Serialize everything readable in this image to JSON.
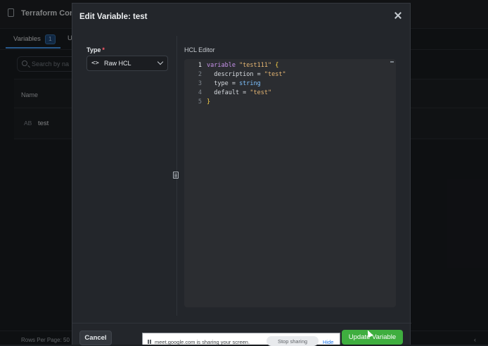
{
  "background": {
    "app_title": "Terraform Con",
    "tabs": [
      {
        "label": "Variables",
        "badge": "1"
      },
      {
        "label": "U"
      }
    ],
    "search_placeholder": "Search by na",
    "table": {
      "header_name": "Name",
      "rows": [
        {
          "type_abbr": "AB",
          "name": "test"
        }
      ]
    },
    "footer": {
      "rows_per_page": "Rows Per Page:  50",
      "pager_prev": "‹"
    }
  },
  "modal": {
    "title": "Edit Variable: test",
    "type_label": "Type",
    "required_mark": "*",
    "type_value_icon": "<>",
    "type_value": "Raw HCL",
    "editor_label": "HCL Editor",
    "code_lines": [
      {
        "num": "1",
        "tokens": [
          {
            "t": "variable ",
            "c": "kw"
          },
          {
            "t": "\"test111\"",
            "c": "str"
          },
          {
            "t": " {",
            "c": "brace"
          }
        ]
      },
      {
        "num": "2",
        "tokens": [
          {
            "t": "  description = ",
            "c": "prop"
          },
          {
            "t": "\"test\"",
            "c": "str"
          }
        ]
      },
      {
        "num": "3",
        "tokens": [
          {
            "t": "  type = ",
            "c": "prop"
          },
          {
            "t": "string",
            "c": "typ"
          }
        ]
      },
      {
        "num": "4",
        "tokens": [
          {
            "t": "  default = ",
            "c": "prop"
          },
          {
            "t": "\"test\"",
            "c": "str"
          }
        ]
      },
      {
        "num": "5",
        "tokens": [
          {
            "t": "}",
            "c": "brace"
          }
        ]
      }
    ],
    "cancel_label": "Cancel",
    "update_label": "Update Variable"
  },
  "share_bar": {
    "message": "meet.google.com is sharing your screen.",
    "stop_label": "Stop sharing",
    "hide_label": "Hide"
  },
  "colors": {
    "accent": "#4aa3ff",
    "primary_button": "#3fae3f",
    "required": "#ff5b6b"
  }
}
